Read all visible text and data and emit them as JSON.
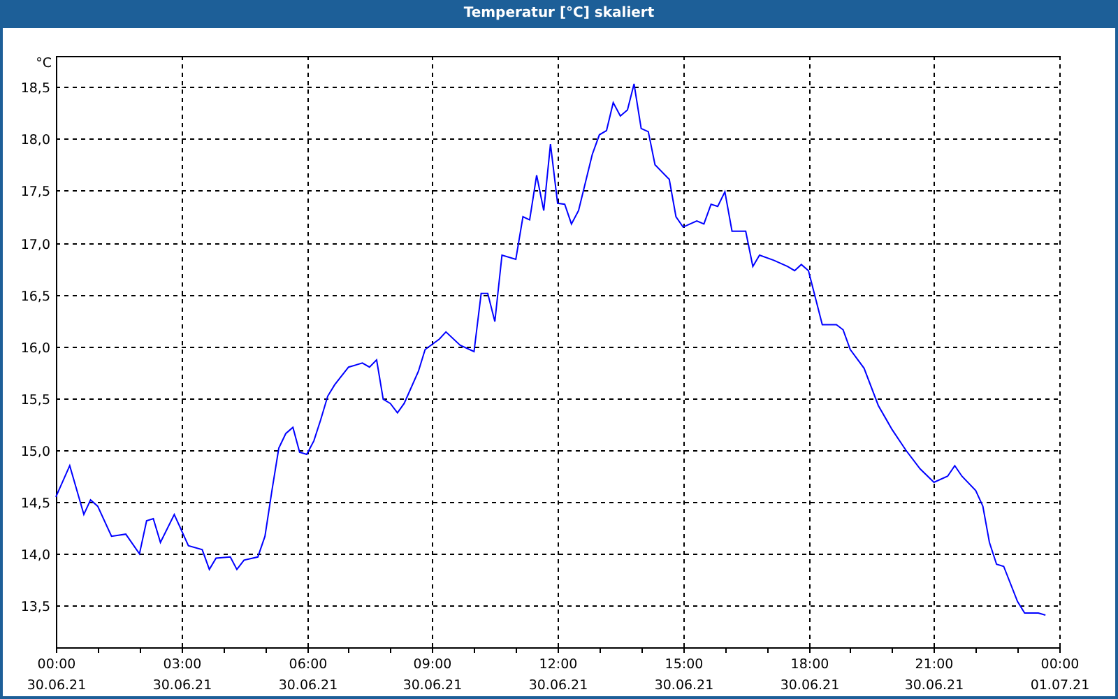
{
  "window": {
    "title": "Temperatur [°C] skaliert"
  },
  "chart": {
    "chart_data": {
      "type": "line",
      "grid": true,
      "ylabel": "°C",
      "xlim": [
        0,
        24
      ],
      "ylim": [
        13.1,
        18.8
      ],
      "xticks": [
        {
          "value": 0,
          "label": "00:00"
        },
        {
          "value": 3,
          "label": "03:00"
        },
        {
          "value": 6,
          "label": "06:00"
        },
        {
          "value": 9,
          "label": "09:00"
        },
        {
          "value": 12,
          "label": "12:00"
        },
        {
          "value": 15,
          "label": "15:00"
        },
        {
          "value": 18,
          "label": "18:00"
        },
        {
          "value": 21,
          "label": "21:00"
        },
        {
          "value": 24,
          "label": "00:00"
        }
      ],
      "yticks": [
        {
          "value": 13.5,
          "label": "13,5"
        },
        {
          "value": 14,
          "label": "14,0"
        },
        {
          "value": 14.5,
          "label": "14,5"
        },
        {
          "value": 15,
          "label": "15,0"
        },
        {
          "value": 15.5,
          "label": "15,5"
        },
        {
          "value": 16,
          "label": "16,0"
        },
        {
          "value": 16.5,
          "label": "16,5"
        },
        {
          "value": 17,
          "label": "17,0"
        },
        {
          "value": 17.5,
          "label": "17,5"
        },
        {
          "value": 18,
          "label": "18,0"
        },
        {
          "value": 18.5,
          "label": "18,5"
        }
      ],
      "x": [
        0,
        0.33,
        0.67,
        0.83,
        1,
        1.33,
        1.67,
        2,
        2.17,
        2.33,
        2.5,
        2.83,
        3.17,
        3.5,
        3.67,
        3.83,
        4.17,
        4.33,
        4.5,
        4.83,
        5,
        5.17,
        5.33,
        5.5,
        5.67,
        5.83,
        6,
        6.17,
        6.33,
        6.5,
        6.67,
        7,
        7.33,
        7.5,
        7.67,
        7.83,
        8,
        8.17,
        8.33,
        8.67,
        8.83,
        9.17,
        9.33,
        9.67,
        10,
        10.17,
        10.33,
        10.5,
        10.67,
        11,
        11.17,
        11.33,
        11.5,
        11.67,
        11.83,
        12,
        12.17,
        12.33,
        12.5,
        12.83,
        13,
        13.17,
        13.33,
        13.5,
        13.67,
        13.83,
        14,
        14.17,
        14.33,
        14.67,
        14.83,
        15,
        15.33,
        15.5,
        15.67,
        15.83,
        16,
        16.17,
        16.5,
        16.67,
        16.83,
        17.17,
        17.5,
        17.67,
        17.83,
        18,
        18.33,
        18.67,
        18.83,
        19,
        19.33,
        19.67,
        20,
        20.33,
        20.67,
        21,
        21.33,
        21.5,
        21.67,
        22,
        22.17,
        22.33,
        22.5,
        22.67,
        23,
        23.17,
        23.5,
        23.67
      ],
      "series": [
        {
          "color": "#0000ff",
          "values": [
            14.55,
            14.85,
            14.38,
            14.52,
            14.46,
            14.17,
            14.19,
            14.0,
            14.32,
            14.34,
            14.11,
            14.38,
            14.08,
            14.04,
            13.85,
            13.96,
            13.97,
            13.85,
            13.94,
            13.97,
            14.17,
            14.62,
            15.02,
            15.16,
            15.22,
            14.98,
            14.96,
            15.09,
            15.29,
            15.52,
            15.63,
            15.8,
            15.84,
            15.8,
            15.87,
            15.49,
            15.45,
            15.36,
            15.45,
            15.76,
            15.97,
            16.07,
            16.14,
            16.01,
            15.95,
            16.51,
            16.51,
            16.24,
            16.88,
            16.84,
            17.25,
            17.22,
            17.65,
            17.31,
            17.95,
            17.38,
            17.37,
            17.18,
            17.31,
            17.85,
            18.04,
            18.08,
            18.35,
            18.22,
            18.28,
            18.53,
            18.1,
            18.07,
            17.75,
            17.61,
            17.25,
            17.15,
            17.21,
            17.18,
            17.37,
            17.35,
            17.49,
            17.11,
            17.11,
            16.77,
            16.88,
            16.83,
            16.77,
            16.73,
            16.79,
            16.73,
            16.21,
            16.21,
            16.16,
            15.97,
            15.79,
            15.43,
            15.2,
            15.0,
            14.82,
            14.69,
            14.75,
            14.85,
            14.75,
            14.61,
            14.46,
            14.11,
            13.9,
            13.88,
            13.54,
            13.43,
            13.43,
            13.41
          ]
        }
      ]
    },
    "x_date_labels": [
      "30.06.21",
      "30.06.21",
      "30.06.21",
      "30.06.21",
      "30.06.21",
      "30.06.21",
      "30.06.21",
      "30.06.21",
      "01.07.21"
    ]
  }
}
